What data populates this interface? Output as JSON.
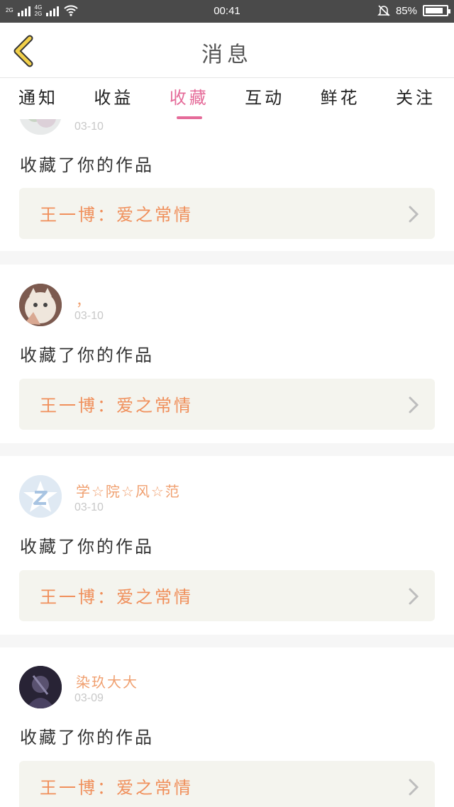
{
  "status_bar": {
    "network_1": "2G",
    "network_2": "4G",
    "network_3": "2G",
    "time": "00:41",
    "battery_text": "85%",
    "battery_level": 0.85
  },
  "header": {
    "title": "消息",
    "back_icon": "back-chevron-icon"
  },
  "tabs": [
    {
      "label": "通知",
      "active": false
    },
    {
      "label": "收益",
      "active": false
    },
    {
      "label": "收藏",
      "active": true
    },
    {
      "label": "互动",
      "active": false
    },
    {
      "label": "鲜花",
      "active": false
    },
    {
      "label": "关注",
      "active": false
    }
  ],
  "items": [
    {
      "user_name": "",
      "date": "03-10",
      "action": "收藏了你的作品",
      "work_title": "王一博：爱之常情"
    },
    {
      "user_name": "，",
      "date": "03-10",
      "action": "收藏了你的作品",
      "work_title": "王一博：爱之常情"
    },
    {
      "user_name": "学☆院☆风☆范",
      "date": "03-10",
      "action": "收藏了你的作品",
      "work_title": "王一博：爱之常情"
    },
    {
      "user_name": "染玖大大",
      "date": "03-09",
      "action": "收藏了你的作品",
      "work_title": "王一博：爱之常情"
    }
  ],
  "colors": {
    "accent": "#e56b99",
    "name": "#f0a070",
    "work_title": "#f08f5b",
    "back_icon": "#f2d04a"
  }
}
